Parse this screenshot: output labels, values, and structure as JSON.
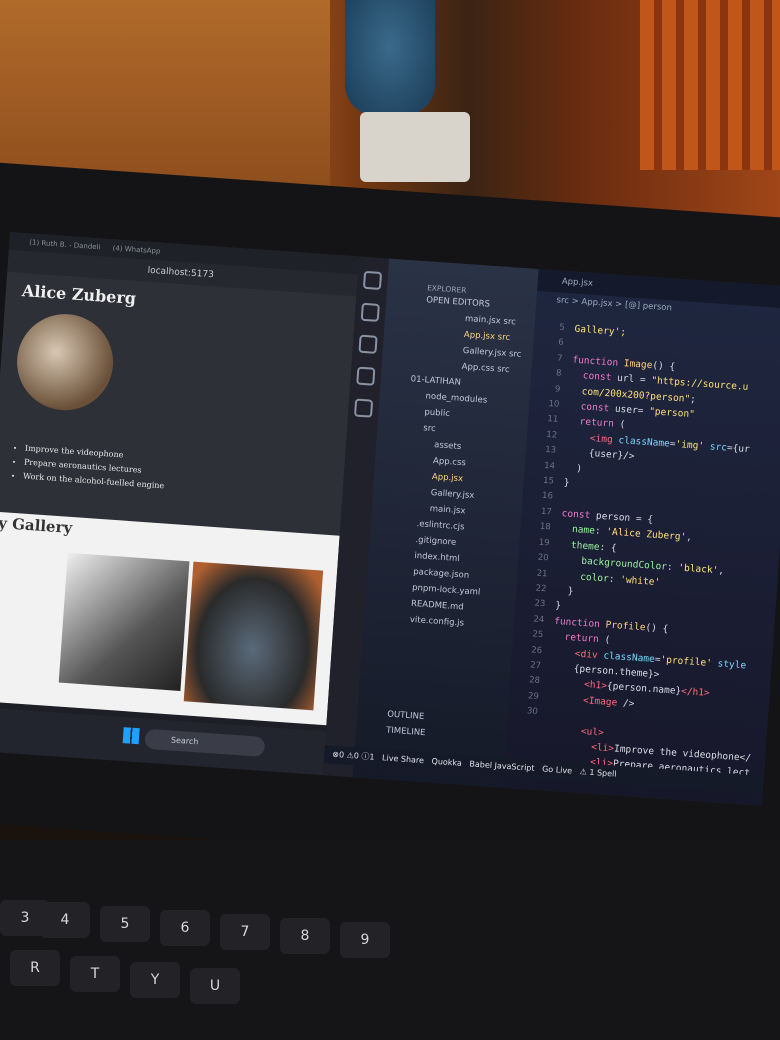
{
  "browser": {
    "tabs": [
      "(1) Ruth B. - Dandeli",
      "(4) WhatsApp"
    ],
    "url": "localhost:5173",
    "profile_name": "Alice Zuberg",
    "list_items": [
      "Improve the videophone",
      "Prepare aeronautics lectures",
      "Work on the alcohol-fuelled engine"
    ],
    "gallery_title": "My Gallery"
  },
  "taskbar": {
    "search_placeholder": "Search"
  },
  "vscode": {
    "title_search": "01-latihan",
    "explorer_label": "EXPLORER",
    "open_editors_label": "OPEN EDITORS",
    "open_editors": [
      "main.jsx src",
      "App.jsx src",
      "Gallery.jsx src",
      "App.css src"
    ],
    "project_label": "01-LATIHAN",
    "tree": [
      "node_modules",
      "public",
      "src",
      "assets",
      "App.css",
      "App.jsx",
      "Gallery.jsx",
      "main.jsx",
      ".eslintrc.cjs",
      ".gitignore",
      "index.html",
      "package.json",
      "pnpm-lock.yaml",
      "README.md",
      "vite.config.js"
    ],
    "outline_label": "OUTLINE",
    "timeline_label": "TIMELINE",
    "active_tab": "App.jsx",
    "breadcrumb": "src > App.jsx > [@] person",
    "line_numbers": [
      "5",
      "6",
      "7",
      "8",
      "9",
      "10",
      "11",
      "12",
      "13",
      "14",
      "15",
      "16",
      "17",
      "18",
      "19",
      "20",
      "21",
      "22",
      "23",
      "24",
      "25",
      "26",
      "27",
      "28",
      "29",
      "30"
    ],
    "status": [
      "⊗0 ⚠0 ⓘ1",
      "Live Share",
      "Quokka",
      "Babel JavaScript",
      "Go Live",
      "⚠ 1 Spell"
    ]
  },
  "keyboard_keys": [
    "#",
    "$",
    "%",
    "&",
    "*",
    "(",
    "R",
    "T",
    "Y",
    "U",
    "3",
    "4",
    "5",
    "6",
    "7",
    "8",
    "9"
  ]
}
